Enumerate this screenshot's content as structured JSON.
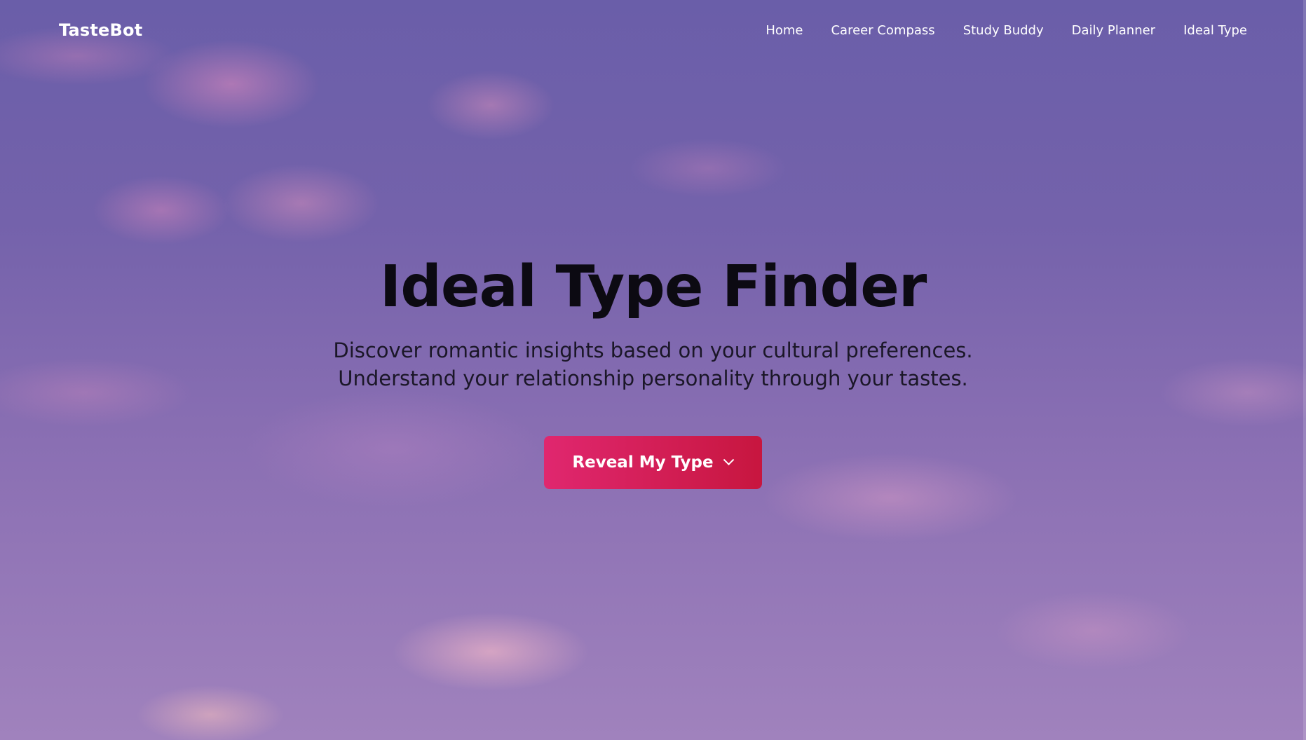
{
  "header": {
    "logo": "TasteBot",
    "nav": [
      {
        "label": "Home"
      },
      {
        "label": "Career Compass"
      },
      {
        "label": "Study Buddy"
      },
      {
        "label": "Daily Planner"
      },
      {
        "label": "Ideal Type"
      }
    ]
  },
  "hero": {
    "title": "Ideal Type Finder",
    "subtitle_line1": "Discover romantic insights based on your cultural preferences.",
    "subtitle_line2": "Understand your relationship personality through your tastes.",
    "cta_label": "Reveal My Type",
    "cta_icon": "chevron-down-icon"
  },
  "colors": {
    "accent": "#d81f56",
    "background_top": "#6a5ea9",
    "background_bottom": "#a082bd"
  }
}
